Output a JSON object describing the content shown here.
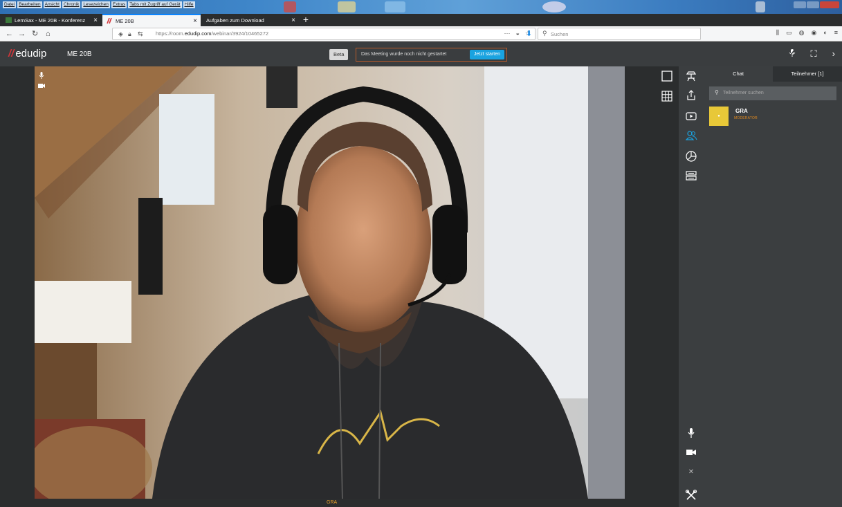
{
  "os_menu": [
    "Datei",
    "Bearbeiten",
    "Ansicht",
    "Chronik",
    "Lesezeichen",
    "Extras",
    "Tabs mit Zugriff auf Gerät",
    "Hilfe"
  ],
  "tabs": [
    {
      "label": "LernSax - ME 20B - Konferenz",
      "active": false
    },
    {
      "label": "ME 20B",
      "active": true
    },
    {
      "label": "Aufgaben zum Download",
      "active": false
    }
  ],
  "new_tab": "+",
  "nav": {
    "url_prefix": "https://room.",
    "url_domain": "edudip.com",
    "url_path": "/webinar/3924/10465272",
    "search_placeholder": "Suchen"
  },
  "app": {
    "logo_mark": "//",
    "logo_text": "edudip",
    "room_name": "ME 20B",
    "beta_label": "Beta",
    "notice_text": "Das Meeting wurde noch nicht gestartet",
    "start_label": "Jetzt starten"
  },
  "video": {
    "participant_name": "GRA"
  },
  "panel": {
    "tab_chat": "Chat",
    "tab_participants": "Teilnehmer [1]",
    "search_placeholder": "Teilnehmer suchen",
    "participants": [
      {
        "name": "GRA",
        "role": "MODERATOR",
        "avatar_color": "#e8c838"
      }
    ]
  },
  "colors": {
    "accent_blue": "#1aa3e0",
    "brand_red": "#d4353a",
    "role_orange": "#e38a1e",
    "app_dark": "#3a3d3f"
  }
}
